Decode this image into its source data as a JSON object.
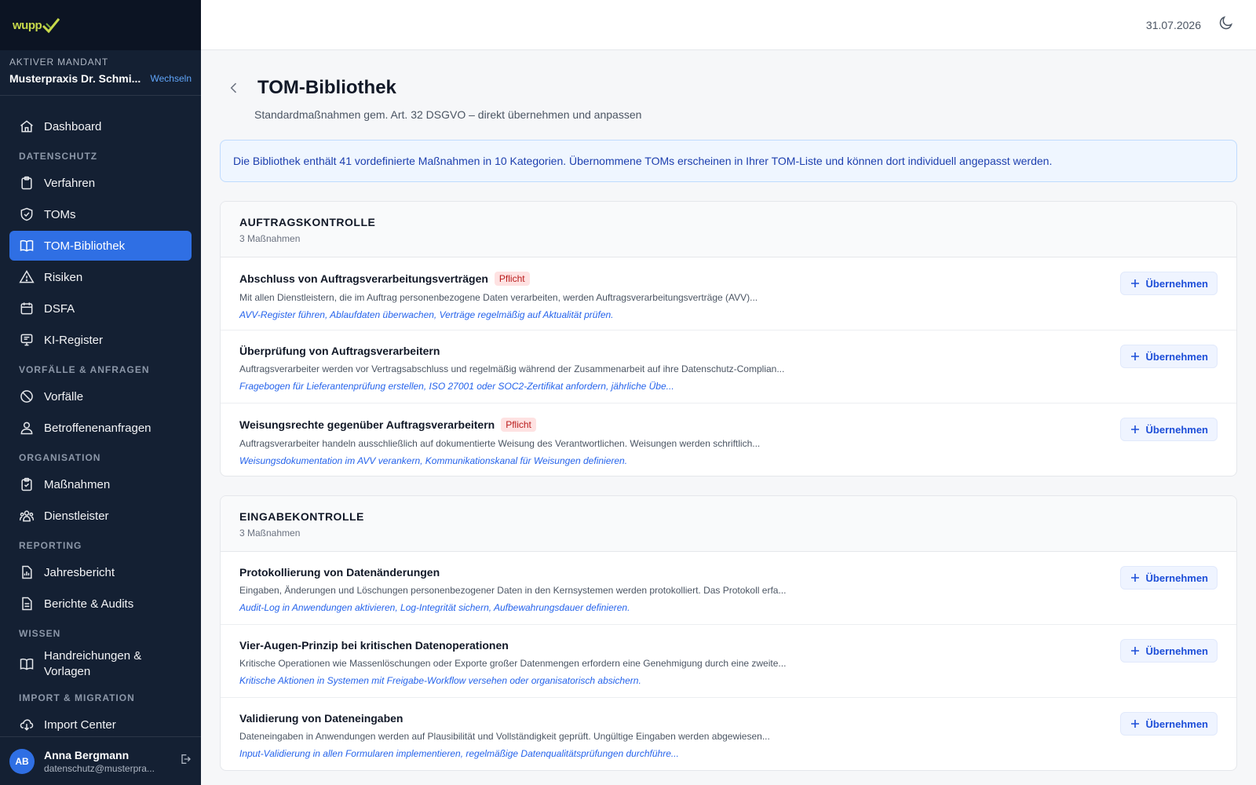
{
  "app": {
    "logo": "wupp"
  },
  "mandant": {
    "caption": "AKTIVER MANDANT",
    "name": "Musterpraxis Dr. Schmi...",
    "switch_label": "Wechseln"
  },
  "nav": {
    "dashboard": "Dashboard",
    "sec_datenschutz": "DATENSCHUTZ",
    "verfahren": "Verfahren",
    "toms": "TOMs",
    "tom_bibliothek": "TOM-Bibliothek",
    "risiken": "Risiken",
    "dsfa": "DSFA",
    "ki_register": "KI-Register",
    "sec_vorfaelle": "VORFÄLLE & ANFRAGEN",
    "vorfaelle": "Vorfälle",
    "betroffenenanfragen": "Betroffenenanfragen",
    "sec_organisation": "ORGANISATION",
    "massnahmen": "Maßnahmen",
    "dienstleister": "Dienstleister",
    "sec_reporting": "REPORTING",
    "jahresbericht": "Jahresbericht",
    "berichte_audits": "Berichte & Audits",
    "sec_wissen": "WISSEN",
    "handreichungen": "Handreichungen & Vorlagen",
    "sec_import": "IMPORT & MIGRATION",
    "import_center": "Import Center"
  },
  "user": {
    "initials": "AB",
    "name": "Anna Bergmann",
    "email": "datenschutz@musterpra..."
  },
  "topbar": {
    "date": "31.07.2026"
  },
  "page": {
    "title": "TOM-Bibliothek",
    "subtitle": "Standardmaßnahmen gem. Art. 32 DSGVO – direkt übernehmen und anpassen",
    "info": "Die Bibliothek enthält 41 vordefinierte Maßnahmen in 10 Kategorien. Übernommene TOMs erscheinen in Ihrer TOM-Liste und können dort individuell angepasst werden.",
    "adopt_label": "Übernehmen",
    "pflicht_label": "Pflicht"
  },
  "categories": [
    {
      "title": "AUFTRAGSKONTROLLE",
      "count": "3 Maßnahmen",
      "items": [
        {
          "title": "Abschluss von Auftragsverarbeitungsverträgen",
          "pflicht": true,
          "desc": "Mit allen Dienstleistern, die im Auftrag personenbezogene Daten verarbeiten, werden Auftragsverarbeitungsverträge (AVV)...",
          "hint": "AVV-Register führen, Ablaufdaten überwachen, Verträge regelmäßig auf Aktualität prüfen."
        },
        {
          "title": "Überprüfung von Auftragsverarbeitern",
          "pflicht": false,
          "desc": "Auftragsverarbeiter werden vor Vertragsabschluss und regelmäßig während der Zusammenarbeit auf ihre Datenschutz-Complian...",
          "hint": "Fragebogen für Lieferantenprüfung erstellen, ISO 27001 oder SOC2-Zertifikat anfordern, jährliche Übe..."
        },
        {
          "title": "Weisungsrechte gegenüber Auftragsverarbeitern",
          "pflicht": true,
          "desc": "Auftragsverarbeiter handeln ausschließlich auf dokumentierte Weisung des Verantwortlichen. Weisungen werden schriftlich...",
          "hint": "Weisungsdokumentation im AVV verankern, Kommunikationskanal für Weisungen definieren."
        }
      ]
    },
    {
      "title": "EINGABEKONTROLLE",
      "count": "3 Maßnahmen",
      "items": [
        {
          "title": "Protokollierung von Datenänderungen",
          "pflicht": false,
          "desc": "Eingaben, Änderungen und Löschungen personenbezogener Daten in den Kernsystemen werden protokolliert. Das Protokoll erfa...",
          "hint": "Audit-Log in Anwendungen aktivieren, Log-Integrität sichern, Aufbewahrungsdauer definieren."
        },
        {
          "title": "Vier-Augen-Prinzip bei kritischen Datenoperationen",
          "pflicht": false,
          "desc": "Kritische Operationen wie Massenlöschungen oder Exporte großer Datenmengen erfordern eine Genehmigung durch eine zweite...",
          "hint": "Kritische Aktionen in Systemen mit Freigabe-Workflow versehen oder organisatorisch absichern."
        },
        {
          "title": "Validierung von Dateneingaben",
          "pflicht": false,
          "desc": "Dateneingaben in Anwendungen werden auf Plausibilität und Vollständigkeit geprüft. Ungültige Eingaben werden abgewiesen...",
          "hint": "Input-Validierung in allen Formularen implementieren, regelmäßige Datenqualitätsprüfungen durchführe..."
        }
      ]
    }
  ]
}
